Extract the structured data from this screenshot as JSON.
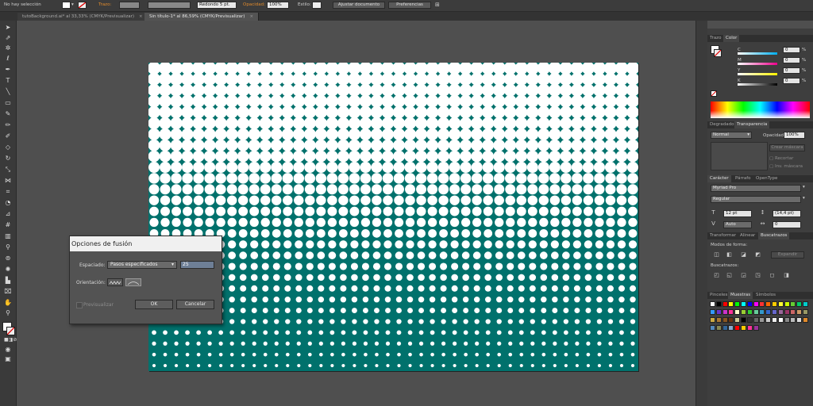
{
  "control_bar": {
    "selection": "No hay selección",
    "stroke_label": "Trazo:",
    "brush_label": "Redondo 5 pt.",
    "opacity_label": "Opacidad:",
    "opacity_value": "100%",
    "style_label": "Estilo:",
    "document_setup": "Ajustar documento",
    "preferences": "Preferencias"
  },
  "doc_tabs": [
    {
      "label": "tutoBackground.ai* al 33,33% (CMYK/Previsualizar)",
      "close": "×"
    },
    {
      "label": "Sin título-1* al 86,59% (CMYK/Previsualizar)",
      "close": "×"
    }
  ],
  "dialog": {
    "title": "Opciones de fusión",
    "spacing_label": "Espaciado:",
    "spacing_value": "Pasos especificados",
    "steps_value": "25",
    "orientation_label": "Orientación:",
    "preview_label": "Previsualizar",
    "ok": "OK",
    "cancel": "Cancelar"
  },
  "color_panel": {
    "tabs": [
      "Trazo",
      "Color"
    ],
    "active_tab": "Color",
    "channels": [
      {
        "label": "C",
        "value": "0",
        "unit": "%"
      },
      {
        "label": "M",
        "value": "0",
        "unit": "%"
      },
      {
        "label": "Y",
        "value": "0",
        "unit": "%"
      },
      {
        "label": "K",
        "value": "0",
        "unit": "%"
      }
    ]
  },
  "transparency_panel": {
    "tabs": [
      "Degradado",
      "Transparencia"
    ],
    "mode": "Normal",
    "opacity_label": "Opacidad:",
    "opacity_value": "100%",
    "make_mask": "Crear máscara",
    "clip": "Recortar",
    "invert_mask": "Inv. máscara"
  },
  "character_panel": {
    "tabs": [
      "Carácter",
      "Párrafo",
      "OpenType"
    ],
    "font": "Myriad Pro",
    "style": "Regular",
    "size": "12 pt",
    "leading": "(14,4 pt)",
    "kerning": "Auto",
    "tracking": "0"
  },
  "pathfinder_panel": {
    "tabs": [
      "Transformar",
      "Alinear",
      "Buscatrazos"
    ],
    "shape_modes_label": "Modos de forma:",
    "expand": "Expandir",
    "pathfinders_label": "Buscatrazos:"
  },
  "swatches_panel": {
    "tabs": [
      "Pinceles",
      "Muestras",
      "Símbolos"
    ],
    "swatch_colors": [
      "#ffffff",
      "#000000",
      "#ff0000",
      "#ffff00",
      "#00ff00",
      "#00ffff",
      "#0000ff",
      "#ff00ff",
      "#ff3333",
      "#ff6600",
      "#ffcc00",
      "#ffff33",
      "#ccff00",
      "#66cc33",
      "#00cc66",
      "#00cccc",
      "#3399ff",
      "#6633cc",
      "#cc33cc",
      "#ff3399",
      "#ffffcc",
      "#99cc33",
      "#33cc33",
      "#66cc99",
      "#3399cc",
      "#3366cc",
      "#6666cc",
      "#996699",
      "#993366",
      "#cc6666",
      "#cc9966",
      "#999966",
      "#ccaa44",
      "#aa7733",
      "#885522",
      "#663311",
      "#cccc99",
      "#000000",
      "#333333",
      "#666666",
      "#999999",
      "#cccccc",
      "#eeeeee",
      "#ffffff",
      "#888888",
      "#bbbbbb",
      "#dddddd",
      "#e08a2c",
      "#5588bb",
      "#888855",
      "#336699",
      "#88aacc",
      "#ff0000",
      "#ffcc00",
      "#ff3399",
      "#993399"
    ],
    "swatch_names": [
      "none-swatch-icon",
      "registration-swatch-icon"
    ]
  },
  "artwork": {
    "teal": "#00716c",
    "rows": 28,
    "cols": 44
  }
}
